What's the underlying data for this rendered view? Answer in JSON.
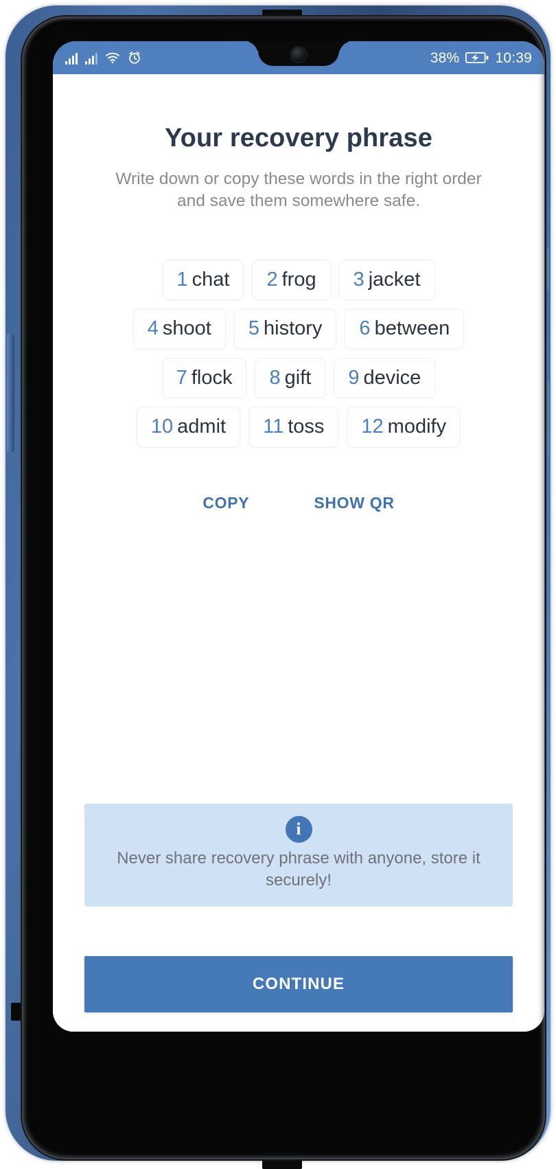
{
  "status_bar": {
    "signal_icon": "signal-bars-icon",
    "signal2_icon": "signal-bars-secondary-icon",
    "wifi_icon": "wifi-icon",
    "alarm_icon": "alarm-clock-icon",
    "battery_percent": "38%",
    "battery_icon": "battery-charging-icon",
    "time": "10:39"
  },
  "screen": {
    "title": "Your recovery phrase",
    "subtitle": "Write down or copy these words in the right order and save them somewhere safe."
  },
  "recovery_phrase": {
    "rows": [
      [
        {
          "num": "1",
          "word": "chat"
        },
        {
          "num": "2",
          "word": "frog"
        },
        {
          "num": "3",
          "word": "jacket"
        }
      ],
      [
        {
          "num": "4",
          "word": "shoot"
        },
        {
          "num": "5",
          "word": "history"
        },
        {
          "num": "6",
          "word": "between"
        }
      ],
      [
        {
          "num": "7",
          "word": "flock"
        },
        {
          "num": "8",
          "word": "gift"
        },
        {
          "num": "9",
          "word": "device"
        }
      ],
      [
        {
          "num": "10",
          "word": "admit"
        },
        {
          "num": "11",
          "word": "toss"
        },
        {
          "num": "12",
          "word": "modify"
        }
      ]
    ]
  },
  "actions": {
    "copy_label": "COPY",
    "show_qr_label": "SHOW QR"
  },
  "info_banner": {
    "icon": "info-icon",
    "icon_glyph": "i",
    "text": "Never share recovery phrase with anyone, store it securely!"
  },
  "footer": {
    "continue_label": "CONTINUE"
  },
  "colors": {
    "accent_blue": "#4579b8",
    "status_bar_blue": "#4f7fbe",
    "chip_number_blue": "#4a7fc1",
    "link_blue": "#4072ad",
    "banner_bg": "#cfe1f5",
    "title_navy": "#2c3a4f",
    "muted_gray": "#8a8a8a"
  }
}
